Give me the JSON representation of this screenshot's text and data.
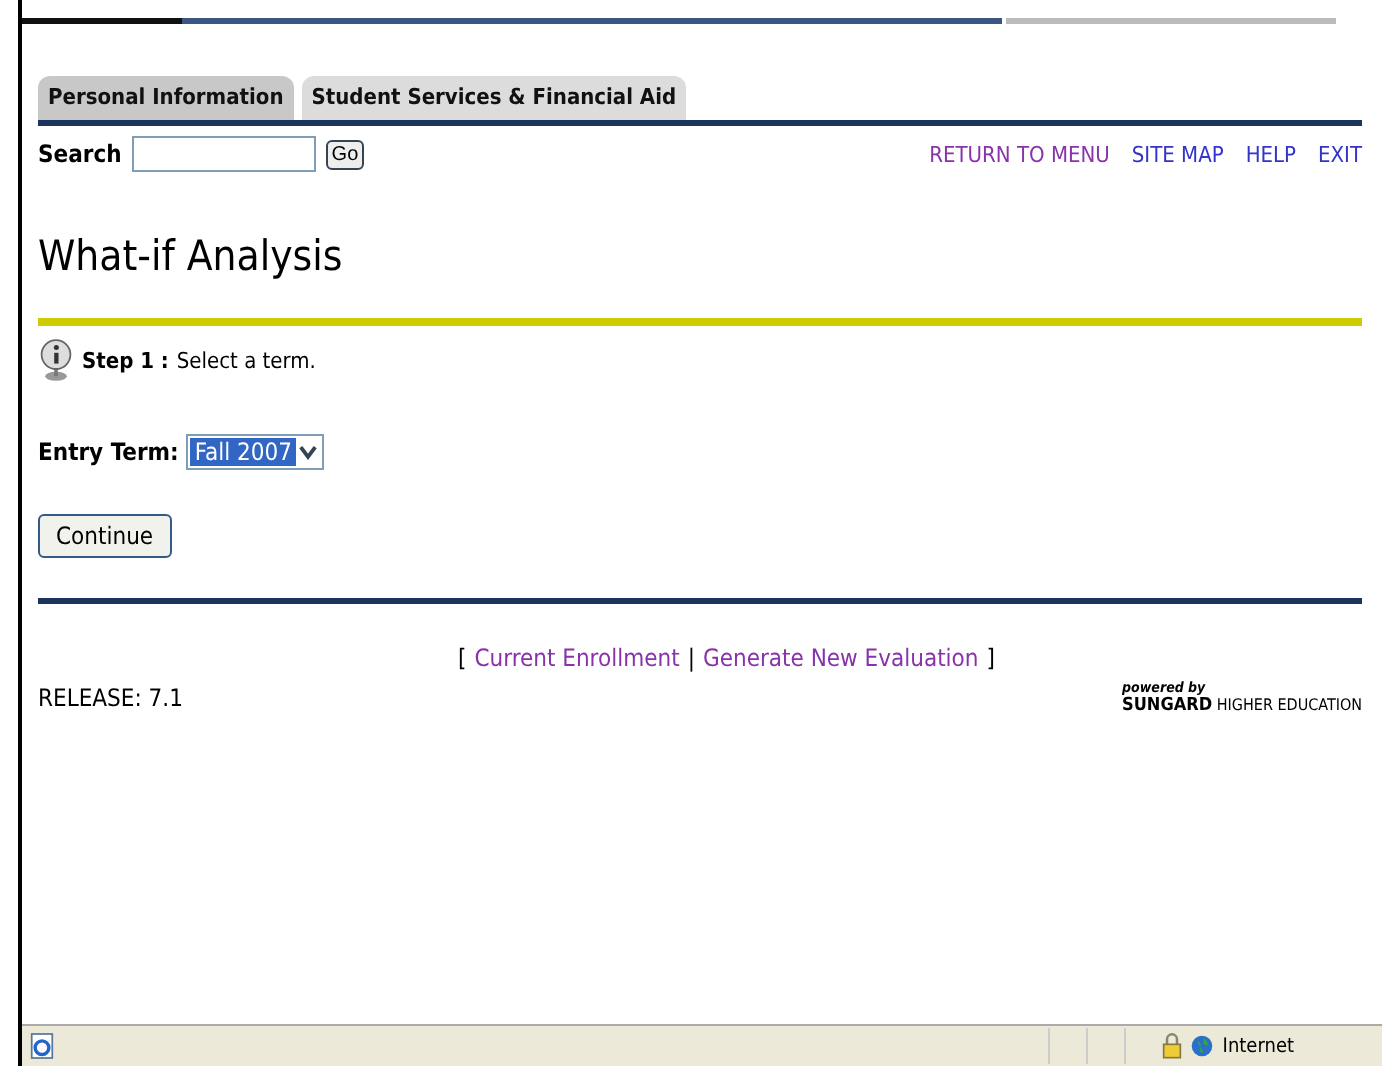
{
  "tabs": [
    {
      "label": "Personal Information",
      "selected": false
    },
    {
      "label": "Student Services & Financial Aid",
      "selected": true
    }
  ],
  "search": {
    "label": "Search",
    "button": "Go"
  },
  "nav_links": [
    "RETURN TO MENU",
    "SITE MAP",
    "HELP",
    "EXIT"
  ],
  "page_title": "What-if Analysis",
  "step": {
    "label": "Step 1 :",
    "text": "Select a term."
  },
  "entry_term": {
    "label": "Entry Term:",
    "value": "Fall 2007"
  },
  "continue_button": "Continue",
  "footer_links": {
    "open": "[",
    "links": [
      "Current Enrollment",
      "Generate New Evaluation"
    ],
    "separator": "|",
    "close": "]"
  },
  "release": "RELEASE: 7.1",
  "powered_by": {
    "caption": "powered by",
    "brand": "SUNGARD",
    "suffix": "HIGHER EDUCATION"
  },
  "status_bar": {
    "zone": "Internet"
  }
}
